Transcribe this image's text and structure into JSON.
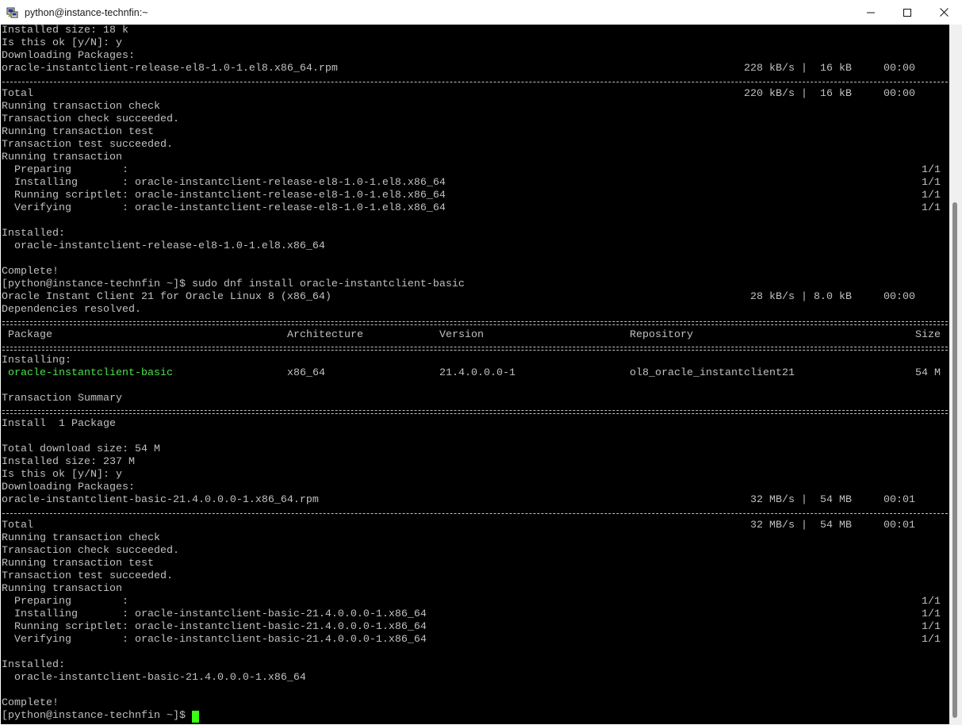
{
  "window": {
    "title": "python@instance-technfin:~",
    "minimize_glyph": "─",
    "maximize_glyph": "☐",
    "close_glyph": "✕",
    "icon": "putty-icon"
  },
  "terminal": {
    "lines": [
      "Installed size: 18 k",
      "Is this ok [y/N]: y",
      "Downloading Packages:",
      "oracle-instantclient-release-el8-1.0-1.el8.x86_64.rpm",
      "",
      "Total",
      "Running transaction check",
      "Transaction check succeeded.",
      "Running transaction test",
      "Transaction test succeeded.",
      "Running transaction",
      "  Preparing        :",
      "  Installing       : oracle-instantclient-release-el8-1.0-1.el8.x86_64",
      "  Running scriptlet: oracle-instantclient-release-el8-1.0-1.el8.x86_64",
      "  Verifying        : oracle-instantclient-release-el8-1.0-1.el8.x86_64",
      "",
      "Installed:",
      "  oracle-instantclient-release-el8-1.0-1.el8.x86_64",
      "",
      "Complete!",
      "[python@instance-technfin ~]$ sudo dnf install oracle-instantclient-basic",
      "Oracle Instant Client 21 for Oracle Linux 8 (x86_64)",
      "Dependencies resolved.",
      "",
      "",
      "",
      "",
      "Installing:",
      "",
      "",
      "Transaction Summary",
      "",
      "Install  1 Package",
      "",
      "Total download size: 54 M",
      "Installed size: 237 M",
      "Is this ok [y/N]: y",
      "Downloading Packages:",
      "oracle-instantclient-basic-21.4.0.0.0-1.x86_64.rpm",
      "",
      "Total",
      "Running transaction check",
      "Transaction check succeeded.",
      "Running transaction test",
      "Transaction test succeeded.",
      "Running transaction",
      "  Preparing        :",
      "  Installing       : oracle-instantclient-basic-21.4.0.0.0-1.x86_64",
      "  Running scriptlet: oracle-instantclient-basic-21.4.0.0.0-1.x86_64",
      "  Verifying        : oracle-instantclient-basic-21.4.0.0.0-1.x86_64",
      "",
      "Installed:",
      "  oracle-instantclient-basic-21.4.0.0.0-1.x86_64",
      "",
      "Complete!",
      "[python@instance-technfin ~]$"
    ],
    "speed_release_download": "228 kB/s |  16 kB     00:00",
    "speed_release_total": "220 kB/s |  16 kB     00:00",
    "progress_release": [
      "1/1",
      "1/1",
      "1/1",
      "1/1"
    ],
    "repo_speed": " 28 kB/s | 8.0 kB     00:00",
    "table_header": {
      "package": "Package",
      "architecture": "Architecture",
      "version": "Version",
      "repository": "Repository",
      "size": "Size"
    },
    "package_row": {
      "name": "oracle-instantclient-basic",
      "arch": "x86_64",
      "version": "21.4.0.0.0-1",
      "repo": "ol8_oracle_instantclient21",
      "size": "54 M"
    },
    "speed_basic_download": " 32 MB/s |  54 MB     00:01",
    "speed_basic_total": " 32 MB/s |  54 MB     00:01",
    "progress_basic": [
      "1/1",
      "1/1",
      "1/1",
      "1/1"
    ]
  },
  "colors": {
    "background": "#000000",
    "text": "#c0c0c0",
    "highlight_package": "#4ce34c",
    "cursor": "#39ff14"
  }
}
